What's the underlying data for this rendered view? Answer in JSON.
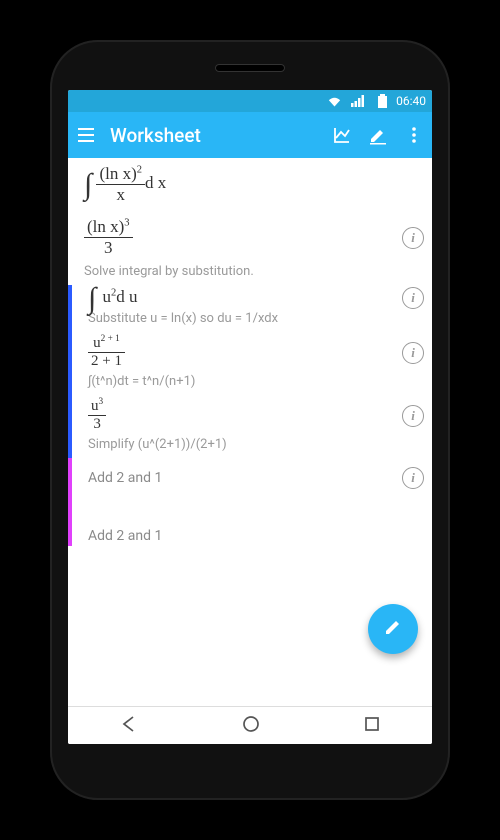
{
  "status": {
    "time": "06:40"
  },
  "appbar": {
    "title": "Worksheet"
  },
  "rows": {
    "r0": {
      "int": "∫",
      "num_base": "(ln x)",
      "num_exp": "2",
      "den": "x",
      "dx": "d x"
    },
    "r1": {
      "num_base": "(ln x)",
      "num_exp": "3",
      "den": "3",
      "hint": "Solve integral by substitution."
    },
    "r2": {
      "int": "∫",
      "u": "u",
      "exp": "2",
      "dx": "d u",
      "hint": "Substitute u = ln(x) so du = 1/xdx"
    },
    "r3": {
      "num_u": "u",
      "num_exp": "2 + 1",
      "den": "2 + 1",
      "hint": "∫(t^n)dt = t^n/(n+1)"
    },
    "r4": {
      "num_u": "u",
      "num_exp": "3",
      "den": "3",
      "hint": "Simplify (u^(2+1))/(2+1)"
    },
    "r5": {
      "text": "Add 2 and 1"
    },
    "r6": {
      "text": "Add 2 and 1"
    }
  }
}
